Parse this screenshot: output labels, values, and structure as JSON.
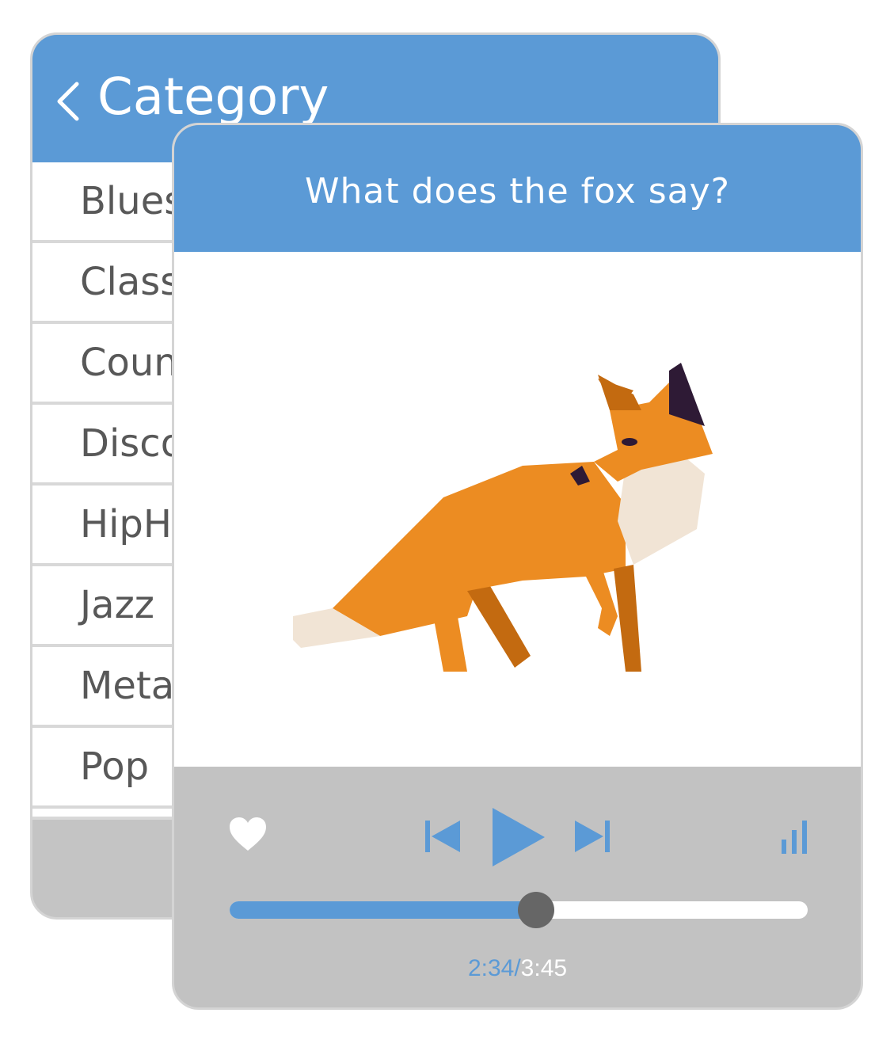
{
  "category_screen": {
    "title": "Category",
    "back_icon": "chevron-left-icon",
    "items": [
      {
        "label": "Blues"
      },
      {
        "label": "Classical"
      },
      {
        "label": "Country"
      },
      {
        "label": "Disco"
      },
      {
        "label": "HipHop"
      },
      {
        "label": "Jazz"
      },
      {
        "label": "Metal"
      },
      {
        "label": "Pop"
      }
    ]
  },
  "player": {
    "song_title": "What does the fox say?",
    "artwork": "fox-illustration",
    "controls": {
      "favorite_icon": "heart-icon",
      "previous_icon": "skip-previous-icon",
      "play_icon": "play-icon",
      "next_icon": "skip-next-icon",
      "levels_icon": "signal-bars-icon"
    },
    "progress": 0.53,
    "time": {
      "elapsed": "2:34",
      "separator": "/",
      "total": "3:45"
    }
  },
  "colors": {
    "accent": "#5b9ad6",
    "controls_bg": "#c2c2c2",
    "text_gray": "#585858",
    "thumb": "#666666",
    "fox_orange": "#ec8c22",
    "fox_dark_orange": "#c36a10",
    "fox_cream": "#f1e4d5",
    "fox_ear": "#2e1a35"
  }
}
